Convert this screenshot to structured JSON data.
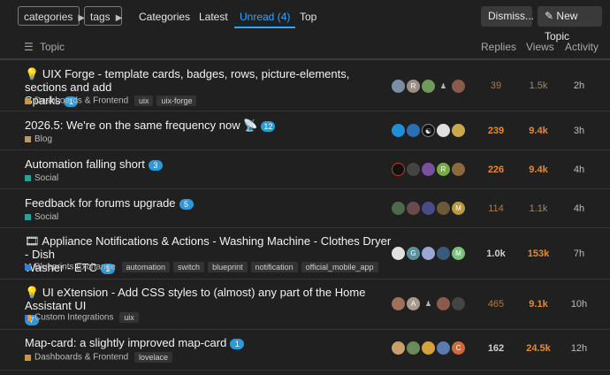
{
  "topbar": {
    "categories_label": "categories",
    "tags_label": "tags",
    "nav": [
      "Categories",
      "Latest",
      "Unread (4)",
      "Top"
    ],
    "dismiss_label": "Dismiss...",
    "new_topic_label": "New Topic"
  },
  "header": {
    "topic": "Topic",
    "replies": "Replies",
    "views": "Views",
    "activity": "Activity"
  },
  "topics": [
    {
      "title": "UIX Forge - template cards, badges, rows, picture-elements, sections and add",
      "title2": "Sparks",
      "emoji": "💡",
      "unread": "1",
      "category": "Dashboards & Frontend",
      "category_color": "#c8963e",
      "tags": [
        "uix",
        "uix-forge"
      ],
      "replies": "39",
      "views": "1.5k",
      "activity": "2h"
    },
    {
      "title": "2026.5: We're on the same frequency now 📡",
      "unread": "12",
      "category": "Blog",
      "category_color": "#b59b6a",
      "tags": [],
      "replies": "239",
      "views": "9.4k",
      "activity": "3h"
    },
    {
      "title": "Automation falling short",
      "unread": "3",
      "category": "Social",
      "category_color": "#2aa198",
      "tags": [],
      "replies": "226",
      "views": "9.4k",
      "activity": "4h"
    },
    {
      "title": "Feedback for forums upgrade",
      "unread": "5",
      "category": "Social",
      "category_color": "#2aa198",
      "tags": [],
      "replies": "114",
      "views": "1.1k",
      "activity": "4h"
    },
    {
      "title": "Appliance Notifications & Actions - Washing Machine - Clothes Dryer - Dish",
      "title2": "Washer - ETC",
      "emoji": "🎞",
      "unread": "1",
      "category": "Blueprints Exchange",
      "category_color": "#2e7fd8",
      "tags": [
        "automation",
        "switch",
        "blueprint",
        "notification",
        "official_mobile_app"
      ],
      "replies": "1.0k",
      "views": "153k",
      "activity": "7h"
    },
    {
      "title": "UI eXtension - Add CSS styles to (almost) any part of the Home Assistant UI",
      "emoji": "💡",
      "unread": "7",
      "category": "Custom Integrations",
      "category_color": "#3a7bd5",
      "tags": [
        "uix"
      ],
      "replies": "465",
      "views": "9.1k",
      "activity": "10h"
    },
    {
      "title": "Map-card: a slightly improved map-card",
      "unread": "1",
      "category": "Dashboards & Frontend",
      "category_color": "#c8963e",
      "tags": [
        "lovelace"
      ],
      "replies": "162",
      "views": "24.5k",
      "activity": "12h"
    }
  ],
  "colors": {
    "accent": "#2ea6ff",
    "hot": "#e68a2e"
  }
}
